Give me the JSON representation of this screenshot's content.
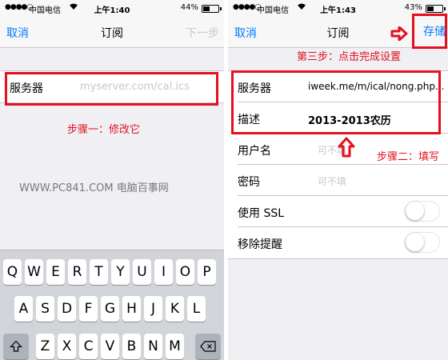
{
  "left": {
    "status": {
      "carrier": "中国电信",
      "time": "上午1:40",
      "battery": "44%",
      "battery_level": 0.44
    },
    "nav": {
      "cancel": "取消",
      "title": "订阅",
      "next": "下一步"
    },
    "server": {
      "label": "服务器",
      "placeholder": "myserver.com/cal.ics"
    },
    "annotation": "步骤一：修改它",
    "watermark": "WWW.PC841.COM 电脑百事网",
    "keyboard": {
      "row1": [
        "Q",
        "W",
        "E",
        "R",
        "T",
        "Y",
        "U",
        "I",
        "O",
        "P"
      ],
      "row2": [
        "A",
        "S",
        "D",
        "F",
        "G",
        "H",
        "J",
        "K",
        "L"
      ],
      "row3": [
        "Z",
        "X",
        "C",
        "V",
        "B",
        "N",
        "M"
      ],
      "shift_icon": "shift-icon",
      "delete_icon": "delete-icon"
    }
  },
  "right": {
    "status": {
      "carrier": "中国电信",
      "time": "上午1:43",
      "battery": "43%",
      "battery_level": 0.43
    },
    "nav": {
      "cancel": "取消",
      "title": "订阅",
      "save": "存储"
    },
    "annotation_step3": "第三步：点击完成设置",
    "annotation_step2": "步骤二：填写",
    "rows": [
      {
        "label": "服务器",
        "value": "iweek.me/m/ical/nong.php...",
        "style": "value"
      },
      {
        "label": "描述",
        "value": "2013-2013农历",
        "style": "bold"
      },
      {
        "label": "用户名",
        "value": "可不填",
        "style": "placeholder"
      },
      {
        "label": "密码",
        "value": "可不填",
        "style": "placeholder"
      },
      {
        "label": "使用 SSL",
        "toggle": false
      },
      {
        "label": "移除提醒",
        "toggle": false
      }
    ]
  },
  "colors": {
    "accent": "#007aff",
    "annotation": "#e3101d",
    "placeholder": "#c7c7cc"
  }
}
